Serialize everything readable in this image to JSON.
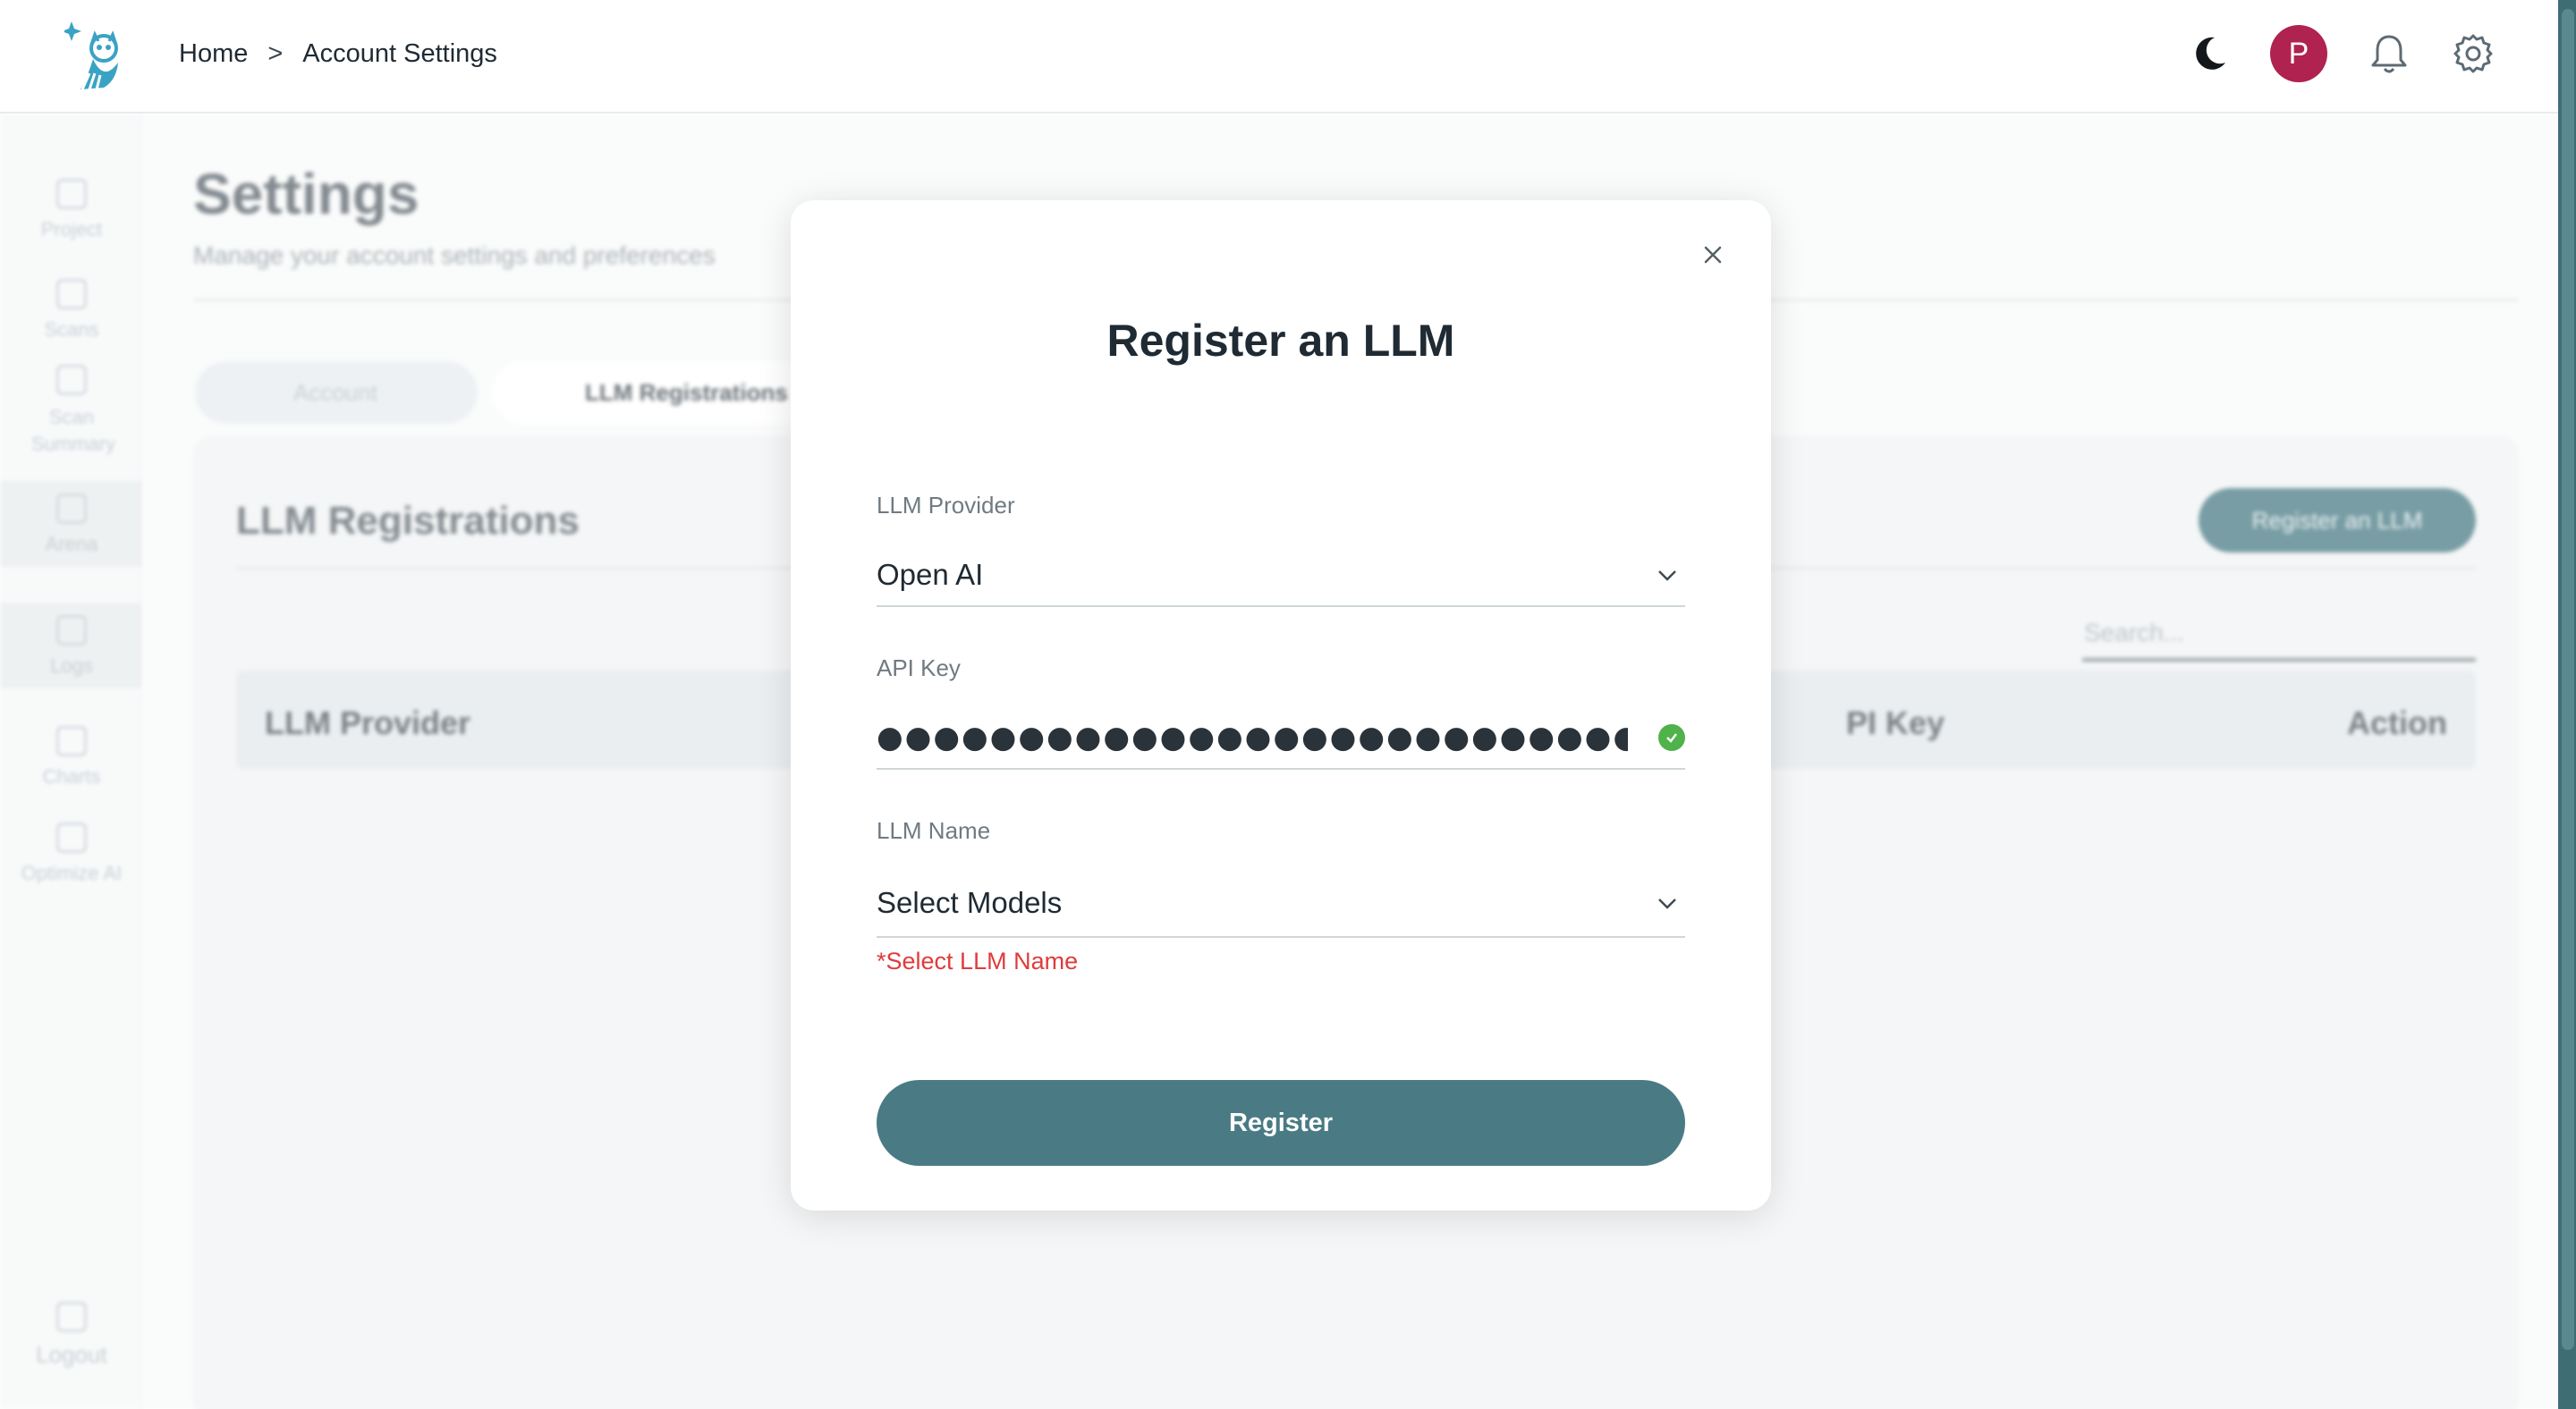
{
  "breadcrumb": {
    "home": "Home",
    "separator": ">",
    "current": "Account Settings"
  },
  "header": {
    "avatar_initial": "P",
    "icons": [
      "moon-icon",
      "bell-icon",
      "gear-icon"
    ]
  },
  "sidebar": {
    "items": [
      {
        "label": "Project",
        "icon": "grid-icon"
      },
      {
        "label": "Scans",
        "icon": "scan-icon"
      },
      {
        "label": "Scan Summary",
        "icon": "document-icon"
      },
      {
        "label": "Arena",
        "icon": "arena-icon"
      },
      {
        "label": "Logs",
        "icon": "calendar-icon"
      },
      {
        "label": "Charts",
        "icon": "bar-chart-icon"
      },
      {
        "label": "Optimize AI",
        "icon": "optimize-icon"
      }
    ],
    "logout": "Logout"
  },
  "page": {
    "title": "Settings",
    "subtitle": "Manage your account settings and preferences",
    "tabs": [
      {
        "label": "Account"
      },
      {
        "label": "LLM Registrations"
      }
    ]
  },
  "panel": {
    "title": "LLM Registrations",
    "register_button": "Register an LLM",
    "search_placeholder": "Search...",
    "columns": [
      "LLM Provider",
      "PI Key",
      "Action"
    ]
  },
  "modal": {
    "title": "Register an LLM",
    "provider": {
      "label": "LLM Provider",
      "value": "Open AI"
    },
    "api_key": {
      "label": "API Key",
      "value": "●●●●●●●●●●●●●●●●●●●●●●●●●●●●●●●●●●●●●●●●●●●●●●●●●●●"
    },
    "llm_name": {
      "label": "LLM Name",
      "value": "Select Models"
    },
    "error": "*Select LLM Name",
    "submit": "Register"
  },
  "colors": {
    "accent": "#4a7b85",
    "avatar": "#b0224f",
    "error": "#e03b3b",
    "valid": "#4fb24a"
  }
}
